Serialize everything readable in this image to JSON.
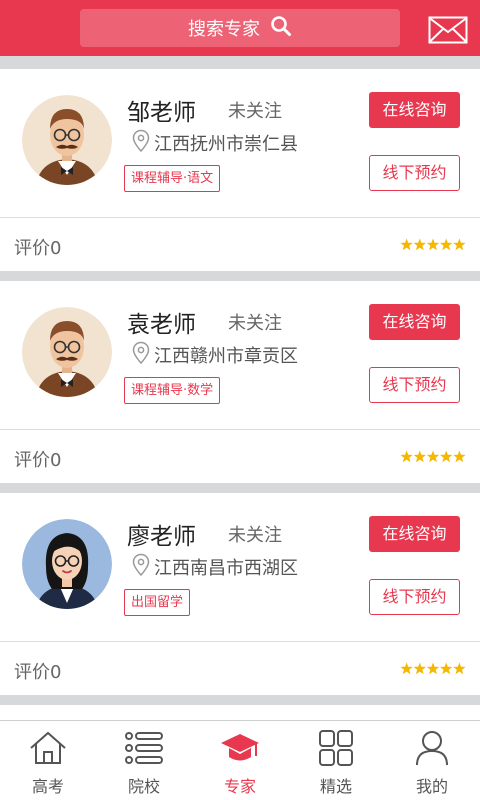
{
  "header": {
    "search_label": "搜索专家",
    "search_icon": "search-icon",
    "mail_icon": "mail-icon"
  },
  "experts": [
    {
      "name": "邹老师",
      "follow": "未关注",
      "location": "江西抚州市崇仁县",
      "tag": "课程辅导·语文",
      "btn_online": "在线咨询",
      "btn_offline": "线下预约",
      "rating_label": "评价0",
      "stars": 5,
      "avatar": "male-avatar"
    },
    {
      "name": "袁老师",
      "follow": "未关注",
      "location": "江西赣州市章贡区",
      "tag": "课程辅导·数学",
      "btn_online": "在线咨询",
      "btn_offline": "线下预约",
      "rating_label": "评价0",
      "stars": 5,
      "avatar": "male-avatar"
    },
    {
      "name": "廖老师",
      "follow": "未关注",
      "location": "江西南昌市西湖区",
      "tag": "出国留学",
      "btn_online": "在线咨询",
      "btn_offline": "线下预约",
      "rating_label": "评价0",
      "stars": 5,
      "avatar": "female-avatar"
    }
  ],
  "tabs": [
    {
      "label": "高考",
      "icon": "home-icon",
      "active": false
    },
    {
      "label": "院校",
      "icon": "list-icon",
      "active": false
    },
    {
      "label": "专家",
      "icon": "graduation-cap-icon",
      "active": true
    },
    {
      "label": "精选",
      "icon": "grid-icon",
      "active": false
    },
    {
      "label": "我的",
      "icon": "user-icon",
      "active": false
    }
  ],
  "colors": {
    "accent": "#e8384f",
    "star": "#f5b800",
    "page_bg": "#d7d8da"
  }
}
